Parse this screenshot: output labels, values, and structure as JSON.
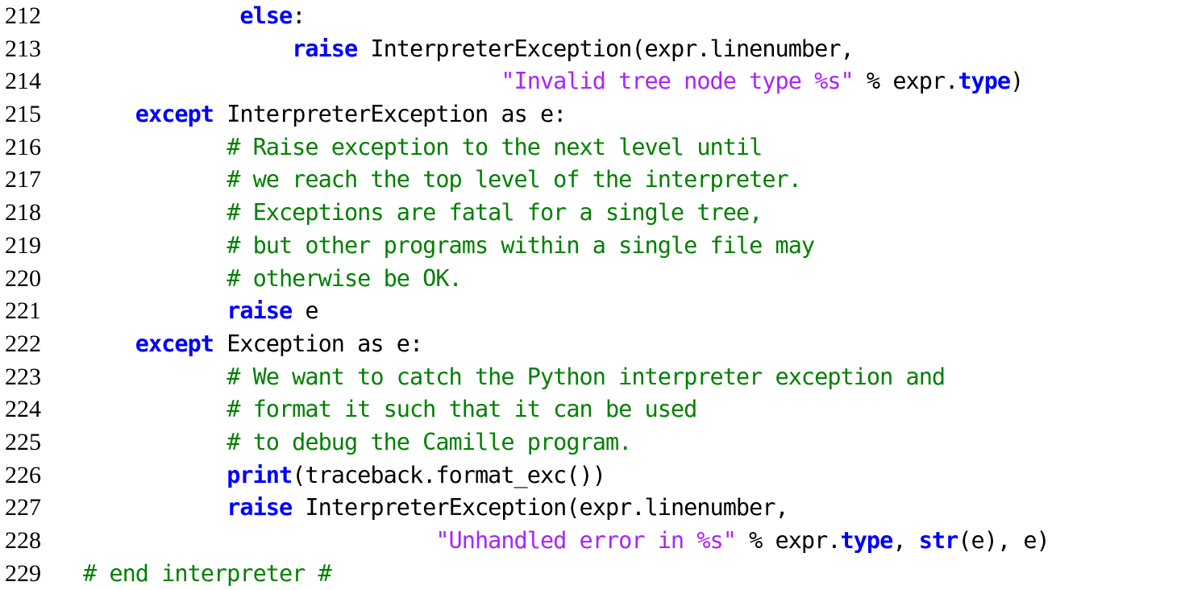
{
  "listing": {
    "language": "python",
    "first_line": 212,
    "last_line": 229,
    "colors": {
      "keyword": "#0000ff",
      "builtin": "#0000ff",
      "string": "#aa22ff",
      "comment": "#008000",
      "plain": "#000000",
      "background": "#ffffff",
      "lineno": "#000000"
    },
    "lines": [
      {
        "no": "212",
        "indent": 12,
        "tokens": [
          {
            "t": "else",
            "k": "kw"
          },
          {
            "t": ":",
            "k": "plain"
          }
        ]
      },
      {
        "no": "213",
        "indent": 16,
        "tokens": [
          {
            "t": "raise",
            "k": "kw"
          },
          {
            "t": " InterpreterException(expr.linenumber,",
            "k": "plain"
          }
        ]
      },
      {
        "no": "214",
        "indent": 32,
        "tokens": [
          {
            "t": "\"Invalid tree node type %s\"",
            "k": "str"
          },
          {
            "t": " % expr.",
            "k": "plain"
          },
          {
            "t": "type",
            "k": "builtin"
          },
          {
            "t": ")",
            "k": "plain"
          }
        ]
      },
      {
        "no": "215",
        "indent": 4,
        "tokens": [
          {
            "t": "except",
            "k": "kw"
          },
          {
            "t": " InterpreterException as e:",
            "k": "plain"
          }
        ]
      },
      {
        "no": "216",
        "indent": 11,
        "tokens": [
          {
            "t": "# Raise exception to the next level until",
            "k": "com"
          }
        ]
      },
      {
        "no": "217",
        "indent": 11,
        "tokens": [
          {
            "t": "# we reach the top level of the interpreter.",
            "k": "com"
          }
        ]
      },
      {
        "no": "218",
        "indent": 11,
        "tokens": [
          {
            "t": "# Exceptions are fatal for a single tree,",
            "k": "com"
          }
        ]
      },
      {
        "no": "219",
        "indent": 11,
        "tokens": [
          {
            "t": "# but other programs within a single file may",
            "k": "com"
          }
        ]
      },
      {
        "no": "220",
        "indent": 11,
        "tokens": [
          {
            "t": "# otherwise be OK.",
            "k": "com"
          }
        ]
      },
      {
        "no": "221",
        "indent": 11,
        "tokens": [
          {
            "t": "raise",
            "k": "kw"
          },
          {
            "t": " e",
            "k": "plain"
          }
        ]
      },
      {
        "no": "222",
        "indent": 4,
        "tokens": [
          {
            "t": "except",
            "k": "kw"
          },
          {
            "t": " Exception as e:",
            "k": "plain"
          }
        ]
      },
      {
        "no": "223",
        "indent": 11,
        "tokens": [
          {
            "t": "# We want to catch the Python interpreter exception and",
            "k": "com"
          }
        ]
      },
      {
        "no": "224",
        "indent": 11,
        "tokens": [
          {
            "t": "# format it such that it can be used",
            "k": "com"
          }
        ]
      },
      {
        "no": "225",
        "indent": 11,
        "tokens": [
          {
            "t": "# to debug the Camille program.",
            "k": "com"
          }
        ]
      },
      {
        "no": "226",
        "indent": 11,
        "tokens": [
          {
            "t": "print",
            "k": "builtin"
          },
          {
            "t": "(traceback.format_exc())",
            "k": "plain"
          }
        ]
      },
      {
        "no": "227",
        "indent": 11,
        "tokens": [
          {
            "t": "raise",
            "k": "kw"
          },
          {
            "t": " InterpreterException(expr.linenumber,",
            "k": "plain"
          }
        ]
      },
      {
        "no": "228",
        "indent": 27,
        "tokens": [
          {
            "t": "\"Unhandled error in %s\"",
            "k": "str"
          },
          {
            "t": " % expr.",
            "k": "plain"
          },
          {
            "t": "type",
            "k": "builtin"
          },
          {
            "t": ", ",
            "k": "plain"
          },
          {
            "t": "str",
            "k": "builtin"
          },
          {
            "t": "(e), e)",
            "k": "plain"
          }
        ]
      },
      {
        "no": "229",
        "indent": 0,
        "tokens": [
          {
            "t": "# end interpreter #",
            "k": "com"
          }
        ]
      }
    ]
  }
}
